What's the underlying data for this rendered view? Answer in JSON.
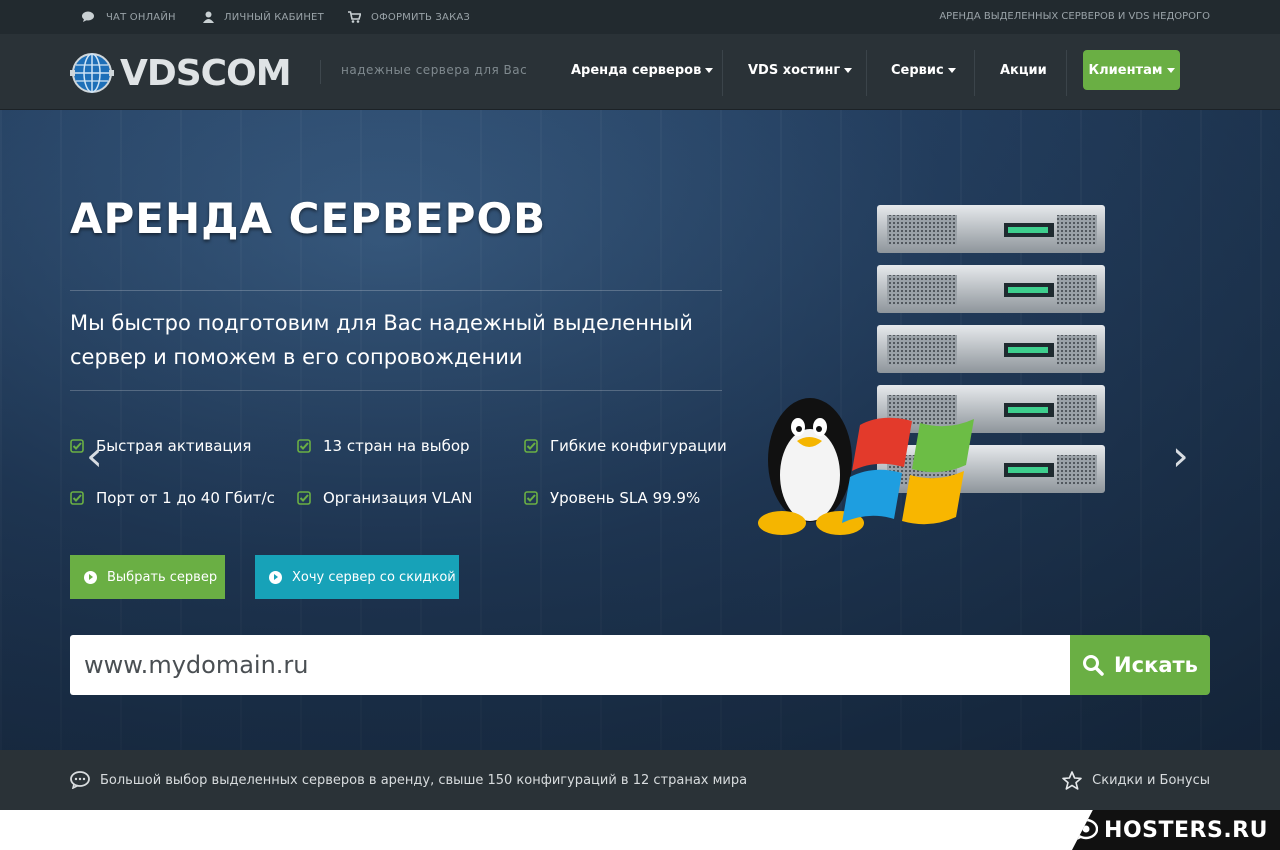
{
  "topbar": {
    "chat": "ЧАТ ОНЛАЙН",
    "cabinet": "ЛИЧНЫЙ КАБИНЕТ",
    "order": "ОФОРМИТЬ ЗАКАЗ",
    "right_text": "АРЕНДА ВЫДЕЛЕННЫХ СЕРВЕРОВ И VDS НЕДОРОГО"
  },
  "nav": {
    "logo": "VDSCOM",
    "tagline": "надежные сервера для Вас",
    "items": [
      {
        "label": "Аренда серверов"
      },
      {
        "label": "VDS хостинг"
      },
      {
        "label": "Сервис"
      },
      {
        "label": "Акции"
      }
    ],
    "clients": "Клиентам"
  },
  "hero": {
    "title": "АРЕНДА СЕРВЕРОВ",
    "subtitle": "Мы быстро подготовим для Вас надежный выделенный сервер и поможем в его сопровождении",
    "features": [
      "Быстрая активация",
      "13 стран на выбор",
      "Гибкие конфигурации",
      "Порт от 1 до 40 Гбит/с",
      "Организация VLAN",
      "Уровень SLA 99.9%"
    ],
    "btn_choose": "Выбрать сервер",
    "btn_discount": "Хочу сервер со скидкой",
    "prev_arrow": "‹",
    "next_arrow": "›"
  },
  "search": {
    "value": "www.mydomain.ru",
    "button": "Искать"
  },
  "infobar": {
    "left": "Большой выбор выделенных серверов в аренду, свыше 150 конфигураций в 12 странах мира",
    "right": "Скидки и Бонусы"
  },
  "watermark": "HOSTERS.RU",
  "colors": {
    "accent_green": "#6aaf44",
    "accent_teal": "#17a2b8",
    "nav_bg": "#2a3237"
  }
}
